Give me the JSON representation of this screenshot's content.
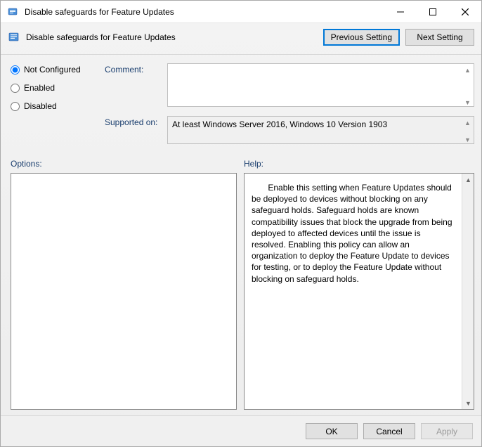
{
  "window": {
    "title": "Disable safeguards for Feature Updates"
  },
  "header": {
    "policy_title": "Disable safeguards for Feature Updates",
    "prev_label": "Previous Setting",
    "next_label": "Next Setting"
  },
  "state": {
    "options": {
      "not_configured": "Not Configured",
      "enabled": "Enabled",
      "disabled": "Disabled"
    },
    "selected": "not_configured"
  },
  "fields": {
    "comment_label": "Comment:",
    "comment_value": "",
    "supported_label": "Supported on:",
    "supported_value": "At least Windows Server 2016, Windows 10 Version 1903"
  },
  "sections": {
    "options_label": "Options:",
    "help_label": "Help:"
  },
  "help_text": "Enable this setting when Feature Updates should be deployed to devices without blocking on any safeguard holds. Safeguard holds are known compatibility issues that block the upgrade from being deployed to affected devices until the issue is resolved. Enabling this policy can allow an organization to deploy the Feature Update to devices for testing, or to deploy the Feature Update without blocking on safeguard holds.",
  "footer": {
    "ok": "OK",
    "cancel": "Cancel",
    "apply": "Apply"
  }
}
